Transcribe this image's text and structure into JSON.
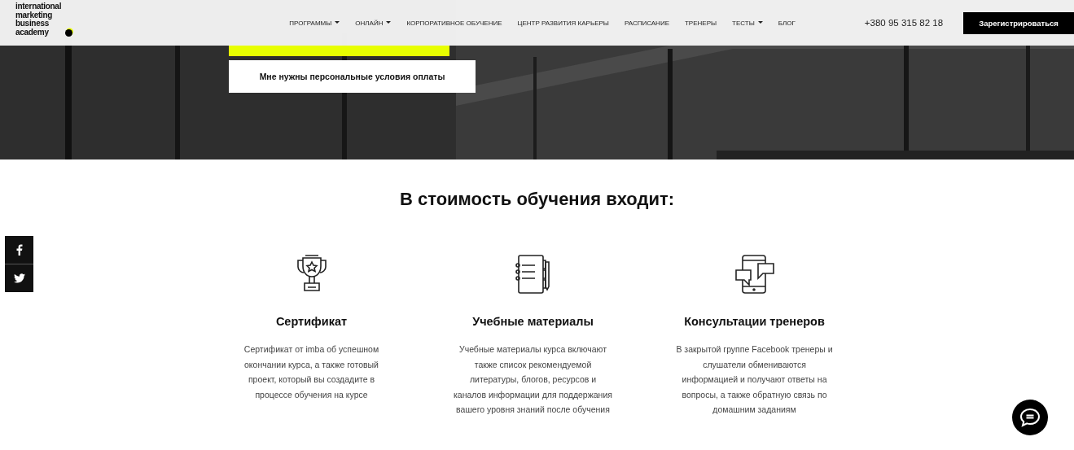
{
  "logo": {
    "text": "international marketing business academy"
  },
  "nav": [
    {
      "label": "ПРОГРАММЫ",
      "dropdown": true
    },
    {
      "label": "ОНЛАЙН",
      "dropdown": true
    },
    {
      "label": "КОРПОРАТИВНОЕ ОБУЧЕНИЕ",
      "dropdown": false
    },
    {
      "label": "ЦЕНТР РАЗВИТИЯ КАРЬЕРЫ",
      "dropdown": false
    },
    {
      "label": "РАСПИСАНИЕ",
      "dropdown": false
    },
    {
      "label": "ТРЕНЕРЫ",
      "dropdown": false
    },
    {
      "label": "ТЕСТЫ",
      "dropdown": true
    },
    {
      "label": "БЛОГ",
      "dropdown": false
    }
  ],
  "phone": "+380 95 315 82 18",
  "register_button": "Зарегистрироваться",
  "hero": {
    "kind": "picture",
    "buttons": [
      {
        "kind": "accent"
      },
      {
        "label": "Мне нужны персональные условия оплаты",
        "kind": "plain"
      }
    ]
  },
  "section_title": "В стоимость обучения входит:",
  "features": [
    {
      "kind": "trophy",
      "title": "Сертификат",
      "text": "Сертификат от imba об успешном окончании курса, а также готовый проект, который вы создадите в процессе обучения на курсе"
    },
    {
      "kind": "notebook",
      "title": "Учебные материалы",
      "text": "Учебные материалы курса включают также список рекомендуемой литературы, блогов, ресурсов и каналов информации для поддержания вашего уровня знаний после обучения"
    },
    {
      "kind": "phone-chat",
      "title": "Консультации тренеров",
      "text": "В закрытой группе Facebook тренеры и слушатели обмениваются информацией и получают ответы на вопросы, а также обратную связь по домашним заданиям"
    }
  ],
  "social": [
    {
      "kind": "facebook"
    },
    {
      "kind": "twitter"
    }
  ]
}
